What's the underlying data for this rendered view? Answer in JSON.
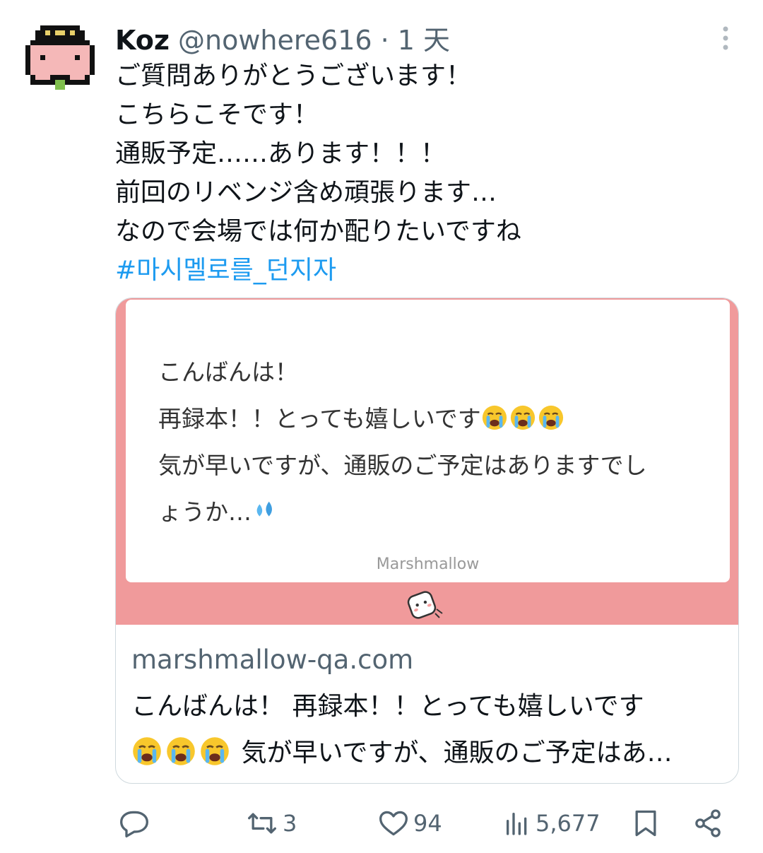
{
  "tweet": {
    "author_name": "Koz",
    "handle": "@nowhere616",
    "separator": "·",
    "time": "1 天",
    "lines": [
      "ご質問ありがとうございます！",
      "こちらこそです！",
      "通販予定……あります！！！",
      "前回のリベンジ含め頑張ります…",
      "なので会場では何か配りたいですね"
    ],
    "hashtag": "#마시멜로를_던지자"
  },
  "card": {
    "quote_lines": [
      "こんばんは！",
      "再録本！！とっても嬉しいです",
      "気が早いですが、通販のご予定はありますでし",
      "ょうか…"
    ],
    "brand": "Marshmallow",
    "domain": "marshmallow-qa.com",
    "desc_line1": "こんばんは！ 再録本！！とっても嬉しいです",
    "desc_line2": "気が早いですが、通販のご予定はあ…"
  },
  "actions": {
    "reply_count": "",
    "retweet_count": "3",
    "like_count": "94",
    "views_count": "5,677"
  },
  "icons": {
    "reply": "speech-bubble-icon",
    "retweet": "retweet-icon",
    "like": "heart-icon",
    "views": "bar-chart-icon",
    "bookmark": "bookmark-icon",
    "share": "share-icon",
    "more": "more-vertical-icon"
  },
  "colors": {
    "hashtag": "#1d9bf0",
    "card_bg": "#f09a9b",
    "muted": "#536471"
  }
}
